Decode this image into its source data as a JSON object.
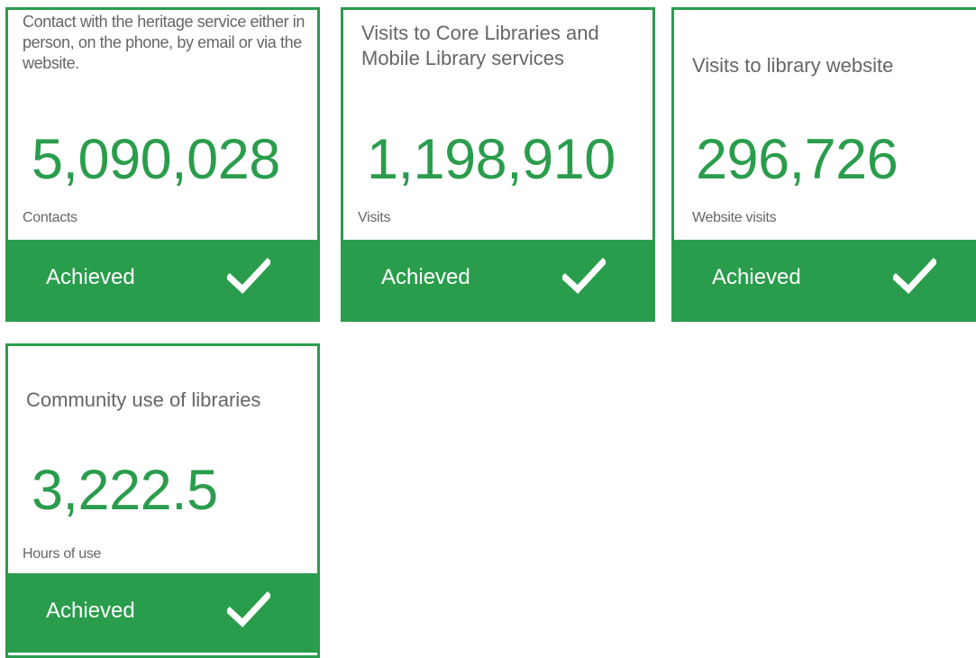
{
  "colors": {
    "accent": "#2a9d4c",
    "label_text": "#666666",
    "status_text": "#ffffff"
  },
  "cards": [
    {
      "title": "Contact with the heritage service either in person, on the phone, by email or via the website.",
      "value": "5,090,028",
      "unit": "Contacts",
      "status": "Achieved",
      "status_icon": "check-icon"
    },
    {
      "title": "Visits to Core Libraries and Mobile Library services",
      "value": "1,198,910",
      "unit": "Visits",
      "status": "Achieved",
      "status_icon": "check-icon"
    },
    {
      "title": "Visits to library website",
      "value": "296,726",
      "unit": "Website visits",
      "status": "Achieved",
      "status_icon": "check-icon"
    },
    {
      "title": "Community use of libraries",
      "value": "3,222.5",
      "unit": "Hours of use",
      "status": "Achieved",
      "status_icon": "check-icon"
    }
  ]
}
